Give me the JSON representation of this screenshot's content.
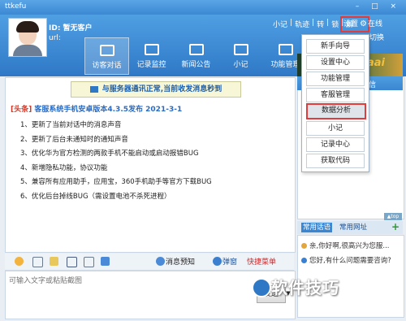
{
  "window": {
    "title": "ttkefu",
    "controls": "– □ ×"
  },
  "visitor": {
    "id_text": "ID: 暂无客户",
    "url_text": "url:"
  },
  "toplinks": [
    "小记",
    "|",
    "轨迹",
    "|",
    "转",
    "|",
    "锁",
    "|",
    "解"
  ],
  "settings_label": "设置",
  "online_label": "在线",
  "switch_label": "切换",
  "nav": [
    {
      "label": "访客对话",
      "active": true
    },
    {
      "label": "记录监控"
    },
    {
      "label": "新闻公告"
    },
    {
      "label": "小记"
    },
    {
      "label": "功能管理"
    }
  ],
  "status_message": "与服务器通讯正常,当前收发消息秒到",
  "announcement": {
    "tag": "[头条]",
    "title": "客服系统手机安卓版本4.3.5发布",
    "date": "2021-3-1",
    "items": [
      "1、更新了当前对话中的消息声音",
      "2、更新了后台未通知时的通知声音",
      "3、优化华为官方检测的两款手机不能启动或启动报错BUG",
      "4、新增隐私功能，协议功能",
      "5、兼容所有应用助手，应用宝，360手机助手等官方下载BUG",
      "6、优化后台掉线BUG（需设置电池不杀死进程）"
    ]
  },
  "toolbar": {
    "preview_label": "消息预知",
    "popup_label": "弹窗",
    "quick_label": "快捷菜单"
  },
  "input": {
    "placeholder": "可输入文字或粘贴截图"
  },
  "send_label": "发送",
  "right_panel": {
    "header_label": "信",
    "top_button": "▲top",
    "tabs": [
      "常用话语",
      "常用网址"
    ],
    "add_label": "+",
    "items": [
      "亲,你好啊,很高兴为您服...",
      "您好,有什么问题需要咨询?"
    ],
    "banner_text": "aai"
  },
  "dropdown_menu": [
    "新手向导",
    "设置中心",
    "功能管理",
    "客服管理",
    "数据分析",
    "小记",
    "记录中心",
    "获取代码"
  ],
  "dropdown_highlighted_index": 4,
  "watermark": "软件技巧",
  "colors": {
    "accent": "#2f78c6",
    "highlight_border": "#e23b3b"
  }
}
